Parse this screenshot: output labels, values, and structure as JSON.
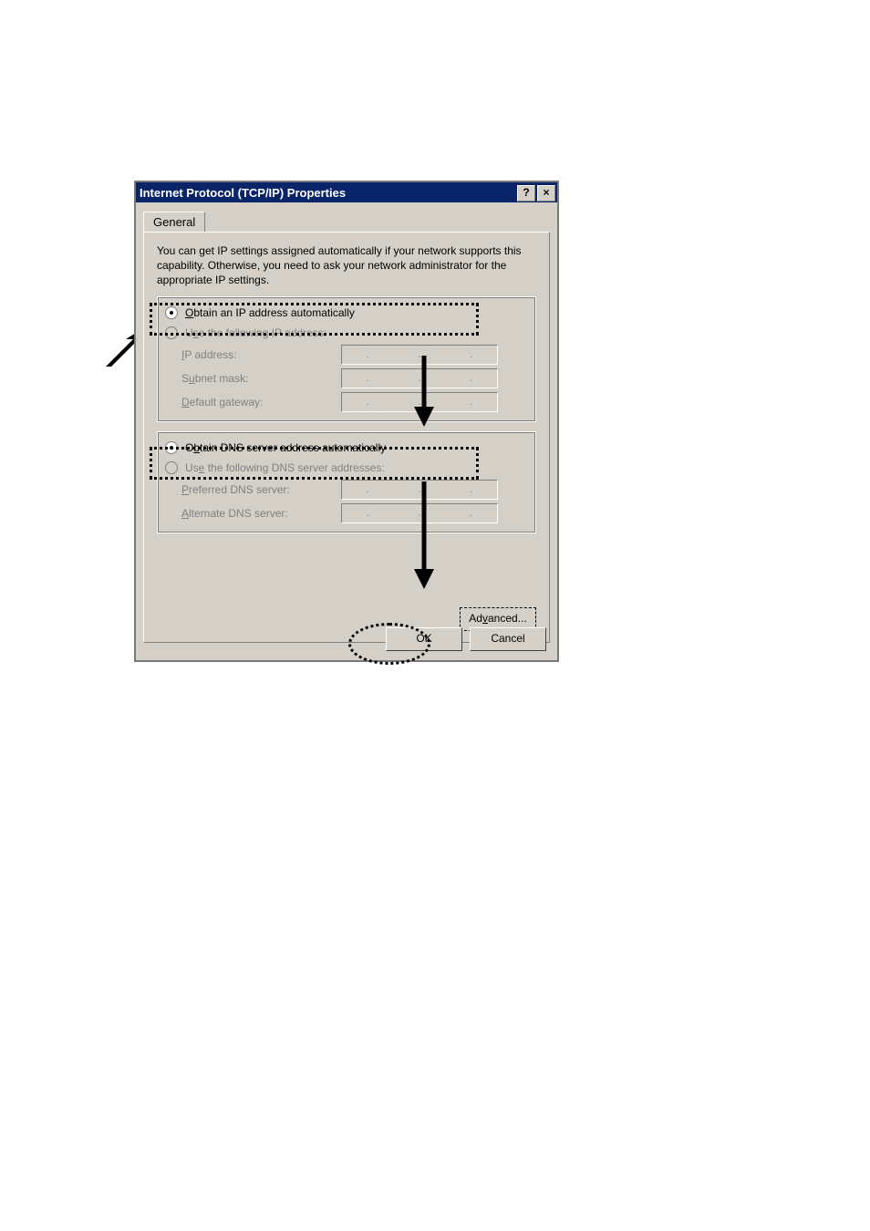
{
  "window": {
    "title": "Internet Protocol (TCP/IP) Properties",
    "help_btn": "?",
    "close_btn": "×"
  },
  "tab": {
    "general": "General"
  },
  "description": "You can get IP settings assigned automatically if your network supports this capability. Otherwise, you need to ask your network administrator for the appropriate IP settings.",
  "ip": {
    "auto_prefix": "O",
    "auto_rest": "btain an IP address automatically",
    "manual_prefix": "U",
    "manual_suffix": "s",
    "manual_rest": "e the following IP address:",
    "addr_prefix": "I",
    "addr_rest": "P address:",
    "mask_prefix": "S",
    "mask_u": "u",
    "mask_rest": "bnet mask:",
    "gw_prefix": "D",
    "gw_rest": "efault gateway:"
  },
  "dns": {
    "auto_prefix": "O",
    "auto_u": "b",
    "auto_rest": "tain DNS server address automatically",
    "manual_prefix": "Us",
    "manual_u": "e",
    "manual_rest": " the following DNS server addresses:",
    "pref_prefix": "P",
    "pref_rest": "referred DNS server:",
    "alt_prefix": "A",
    "alt_rest": "lternate DNS server:"
  },
  "buttons": {
    "advanced_prefix": "Ad",
    "advanced_u": "v",
    "advanced_rest": "anced...",
    "ok": "OK",
    "cancel": "Cancel"
  },
  "dots": {
    "a": ".",
    "b": ".",
    "c": "."
  }
}
